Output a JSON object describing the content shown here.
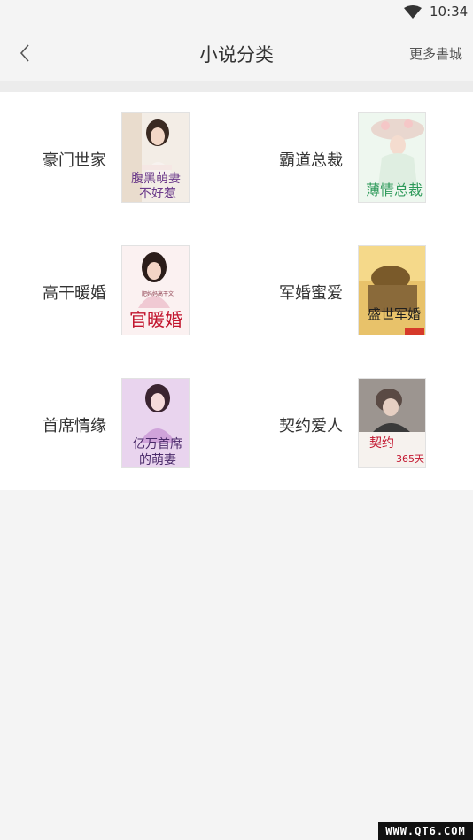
{
  "status_bar": {
    "time": "10:34"
  },
  "header": {
    "title": "小说分类",
    "more_link": "更多書城"
  },
  "categories": [
    {
      "label": "豪门世家",
      "cover_text": "腹黑萌妻不好惹"
    },
    {
      "label": "霸道总裁",
      "cover_text": "薄情总裁"
    },
    {
      "label": "高干暖婚",
      "cover_text": "官暖婚"
    },
    {
      "label": "军婚蜜爱",
      "cover_text": "盛世军婚"
    },
    {
      "label": "首席情缘",
      "cover_text": "亿万首席的萌妻"
    },
    {
      "label": "契约爱人",
      "cover_text": "契约老婆365天"
    }
  ],
  "watermark": "WWW.QT6.COM"
}
